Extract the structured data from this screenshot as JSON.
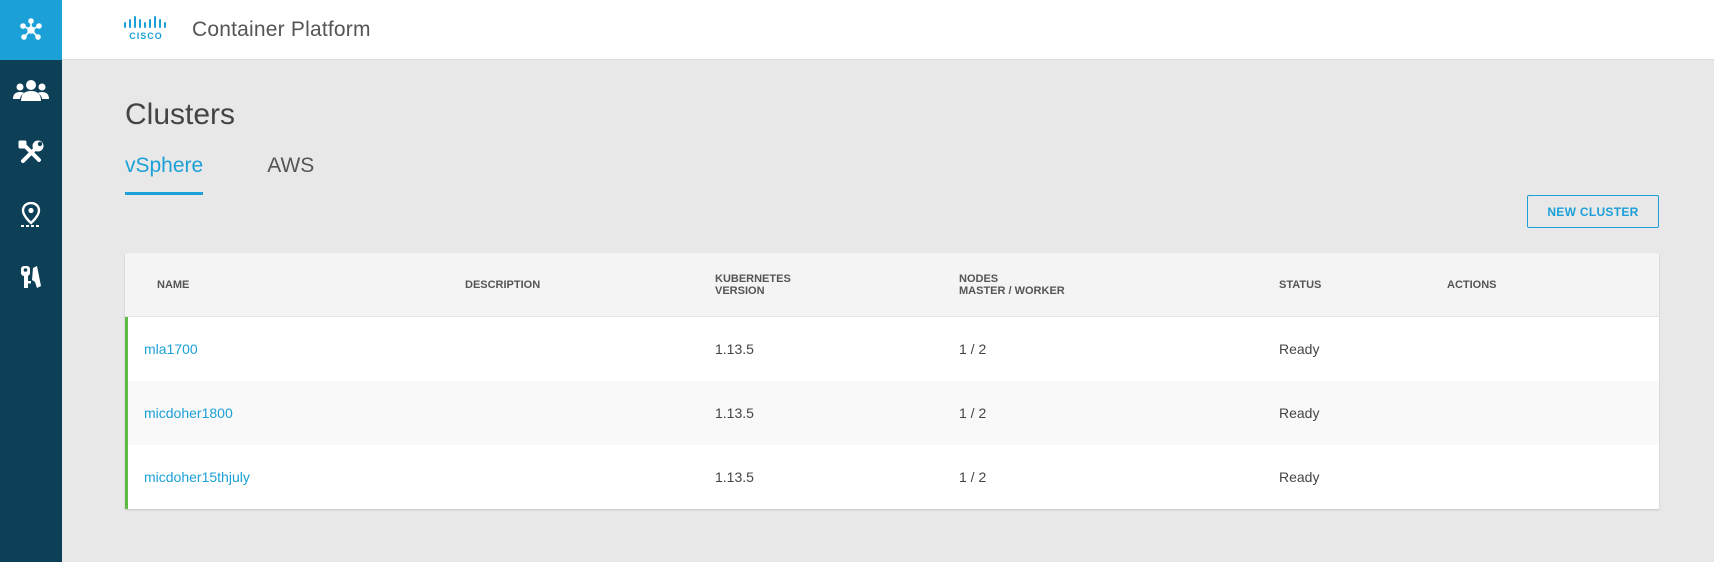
{
  "app": {
    "brand": "CISCO",
    "title": "Container Platform"
  },
  "sidebar": {
    "items": [
      {
        "icon": "clusters-icon",
        "active": true
      },
      {
        "icon": "users-icon",
        "active": false
      },
      {
        "icon": "tools-icon",
        "active": false
      },
      {
        "icon": "location-icon",
        "active": false
      },
      {
        "icon": "keys-icon",
        "active": false
      }
    ]
  },
  "page": {
    "title": "Clusters"
  },
  "tabs": [
    {
      "label": "vSphere",
      "active": true
    },
    {
      "label": "AWS",
      "active": false
    }
  ],
  "actions": {
    "new_cluster": "NEW CLUSTER"
  },
  "table": {
    "headers": {
      "name": "NAME",
      "description": "DESCRIPTION",
      "k8s_line1": "KUBERNETES",
      "k8s_line2": "VERSION",
      "nodes_line1": "NODES",
      "nodes_line2": "MASTER / WORKER",
      "status": "STATUS",
      "actions": "ACTIONS"
    },
    "rows": [
      {
        "name": "mla1700",
        "description": "",
        "version": "1.13.5",
        "nodes": "1 / 2",
        "status": "Ready"
      },
      {
        "name": "micdoher1800",
        "description": "",
        "version": "1.13.5",
        "nodes": "1 / 2",
        "status": "Ready"
      },
      {
        "name": "micdoher15thjuly",
        "description": "",
        "version": "1.13.5",
        "nodes": "1 / 2",
        "status": "Ready"
      }
    ]
  },
  "colors": {
    "accent": "#1ba0d7",
    "sidebar": "#0d3f57",
    "ready": "#5dbb46"
  }
}
